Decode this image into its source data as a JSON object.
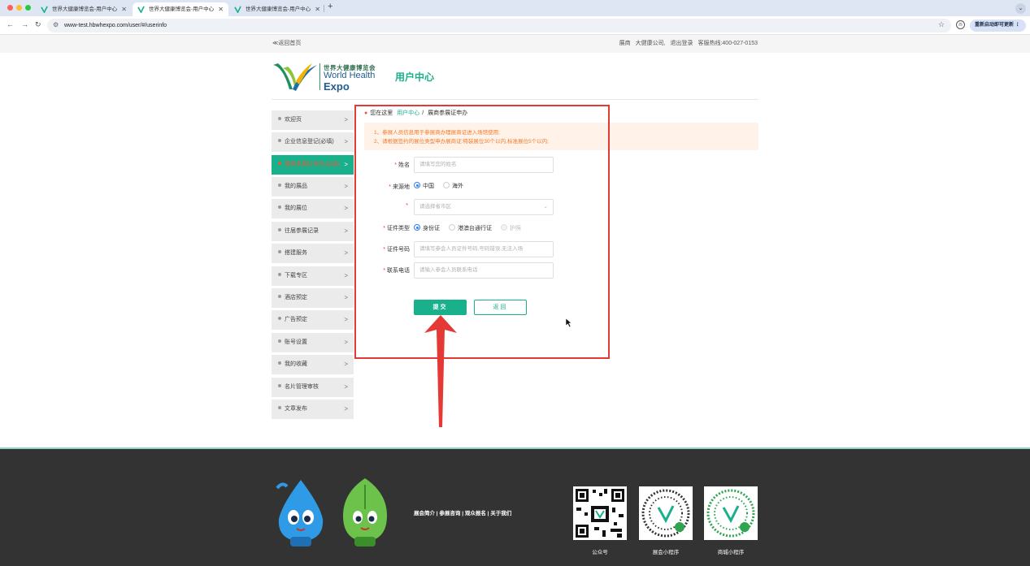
{
  "browser": {
    "tabs": [
      {
        "title": "世界大健康博览会-用户中心"
      },
      {
        "title": "世界大健康博览会-用户中心"
      },
      {
        "title": "世界大健康博览会-用户中心"
      }
    ],
    "new_tab": "+",
    "url": "www-test.hbwhexpo.com/user/#/userinfo",
    "update_button": "重新启动即可更新"
  },
  "topbar": {
    "back_home": "≪返回首页",
    "user_role": "展商",
    "company": "大健康公司,",
    "logout": "退出登录",
    "hotline_label": "客服热线:",
    "hotline": "400-027-0153"
  },
  "header": {
    "logo_cn": "世界大健康博览会",
    "logo_en1": "World Health",
    "logo_en2": "Expo",
    "page_title": "用户中心"
  },
  "sidebar": {
    "items": [
      {
        "label": "欢迎页"
      },
      {
        "label": "企业信息登记(必填)"
      },
      {
        "label": "展商参展证申办(必填)"
      },
      {
        "label": "我的展品"
      },
      {
        "label": "我的展位"
      },
      {
        "label": "往届参展记录"
      },
      {
        "label": "搭建服务"
      },
      {
        "label": "下载专区"
      },
      {
        "label": "酒店预定"
      },
      {
        "label": "广告预定"
      },
      {
        "label": "账号设置"
      },
      {
        "label": "我的收藏"
      },
      {
        "label": "名片管理审核"
      },
      {
        "label": "文章发布"
      }
    ],
    "active_index": 2
  },
  "breadcrumb": {
    "prefix": "您在这里",
    "link": "用户中心",
    "sep": "/",
    "current": "展商参展证申办"
  },
  "notice": {
    "line1": "1、参展人员信息用于参展商办理展商证进入场馆使用;",
    "line2": "2、请根据签约的展位类型申办展商证:特装展位30个以内,标准展位5个以内;"
  },
  "form": {
    "name_label": "姓名",
    "name_placeholder": "请填写您的姓名",
    "origin_label": "来源地",
    "origin_options": [
      "中国",
      "海外"
    ],
    "region_placeholder": "请选择省市区",
    "id_type_label": "证件类型",
    "id_type_options": [
      "身份证",
      "港澳台通行证",
      "护照"
    ],
    "id_no_label": "证件号码",
    "id_no_placeholder": "请填写参会人员证件号码,号码错误,无法入场",
    "phone_label": "联系电话",
    "phone_placeholder": "请输入参会人员联系电话",
    "required_mark": "*",
    "submit_label": "提交",
    "back_label": "返回"
  },
  "footer": {
    "links": "展会简介 | 参展咨询 | 观众报名 | 关于我们",
    "qr_labels": [
      "公众号",
      "展会小程序",
      "商城小程序"
    ]
  },
  "colors": {
    "accent": "#19b08c",
    "annotation_red": "#e53935",
    "notice_text": "#f07a2b",
    "footer_bg": "#333333"
  }
}
